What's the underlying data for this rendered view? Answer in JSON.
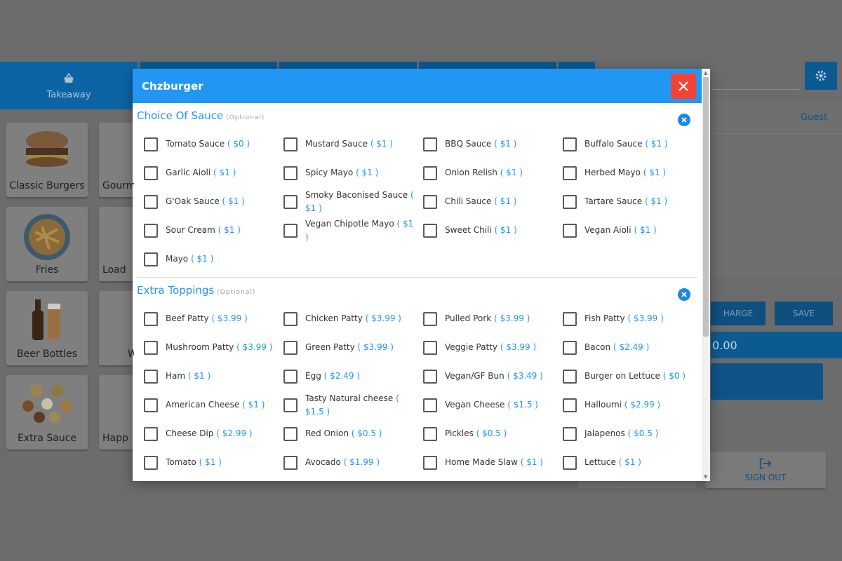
{
  "background": {
    "tabs": [
      {
        "label": "Takeaway",
        "icon": "basket-icon"
      }
    ],
    "categories": [
      {
        "label": "Classic Burgers"
      },
      {
        "label": "Gourm"
      },
      {
        "label": "Fries"
      },
      {
        "label": "Load"
      },
      {
        "label": "Beer Bottles"
      },
      {
        "label": "W"
      },
      {
        "label": "Extra Sauce"
      },
      {
        "label": "Happ"
      }
    ],
    "order_panel": {
      "guest_label": "Guest",
      "charge_label": "HARGE",
      "save_label": "SAVE",
      "total_text": "0.00",
      "sign_out_label": "SIGN OUT"
    }
  },
  "modal": {
    "title": "Chzburger",
    "sections": [
      {
        "title": "Choice Of Sauce",
        "tag": "(Optional)",
        "options": [
          {
            "name": "Tomato Sauce",
            "price": "( $0 )"
          },
          {
            "name": "Mustard Sauce",
            "price": "( $1 )"
          },
          {
            "name": "BBQ Sauce",
            "price": "( $1 )"
          },
          {
            "name": "Buffalo Sauce",
            "price": "( $1 )"
          },
          {
            "name": "Garlic Aioli",
            "price": "( $1 )"
          },
          {
            "name": "Spicy Mayo",
            "price": "( $1 )"
          },
          {
            "name": "Onion Relish",
            "price": "( $1 )"
          },
          {
            "name": "Herbed Mayo",
            "price": "( $1 )"
          },
          {
            "name": "G'Oak Sauce",
            "price": "( $1 )"
          },
          {
            "name": "Smoky Baconised Sauce",
            "price": "( $1 )"
          },
          {
            "name": "Chili Sauce",
            "price": "( $1 )"
          },
          {
            "name": "Tartare Sauce",
            "price": "( $1 )"
          },
          {
            "name": "Sour Cream",
            "price": "( $1 )"
          },
          {
            "name": "Vegan Chipotle Mayo",
            "price": "( $1 )"
          },
          {
            "name": "Sweet Chili",
            "price": "( $1 )"
          },
          {
            "name": "Vegan Aioli",
            "price": "( $1 )"
          },
          {
            "name": "Mayo",
            "price": "( $1 )"
          }
        ]
      },
      {
        "title": "Extra Toppings",
        "tag": "(Optional)",
        "options": [
          {
            "name": "Beef Patty",
            "price": "( $3.99 )"
          },
          {
            "name": "Chicken Patty",
            "price": "( $3.99 )"
          },
          {
            "name": "Pulled Pork",
            "price": "( $3.99 )"
          },
          {
            "name": "Fish Patty",
            "price": "( $3.99 )"
          },
          {
            "name": "Mushroom Patty",
            "price": "( $3.99 )"
          },
          {
            "name": "Green Patty",
            "price": "( $3.99 )"
          },
          {
            "name": "Veggie Patty",
            "price": "( $3.99 )"
          },
          {
            "name": "Bacon",
            "price": "( $2.49 )"
          },
          {
            "name": "Ham",
            "price": "( $1 )"
          },
          {
            "name": "Egg",
            "price": "( $2.49 )"
          },
          {
            "name": "Vegan/GF Bun",
            "price": "( $3.49 )"
          },
          {
            "name": "Burger on Lettuce",
            "price": "( $0 )"
          },
          {
            "name": "American Cheese",
            "price": "( $1 )"
          },
          {
            "name": "Tasty Natural cheese",
            "price": "( $1.5 )"
          },
          {
            "name": "Vegan Cheese",
            "price": "( $1.5 )"
          },
          {
            "name": "Halloumi",
            "price": "( $2.99 )"
          },
          {
            "name": "Cheese Dip",
            "price": "( $2.99 )"
          },
          {
            "name": "Red Onion",
            "price": "( $0.5 )"
          },
          {
            "name": "Pickles",
            "price": "( $0.5 )"
          },
          {
            "name": "Jalapenos",
            "price": "( $0.5 )"
          },
          {
            "name": "Tomato",
            "price": "( $1 )"
          },
          {
            "name": "Avocado",
            "price": "( $1.99 )"
          },
          {
            "name": "Home Made Slaw",
            "price": "( $1 )"
          },
          {
            "name": "Lettuce",
            "price": "( $1 )"
          }
        ]
      }
    ]
  },
  "colors": {
    "primary": "#2196f3",
    "close": "#f44336",
    "overlay": "#6c6c6c"
  }
}
